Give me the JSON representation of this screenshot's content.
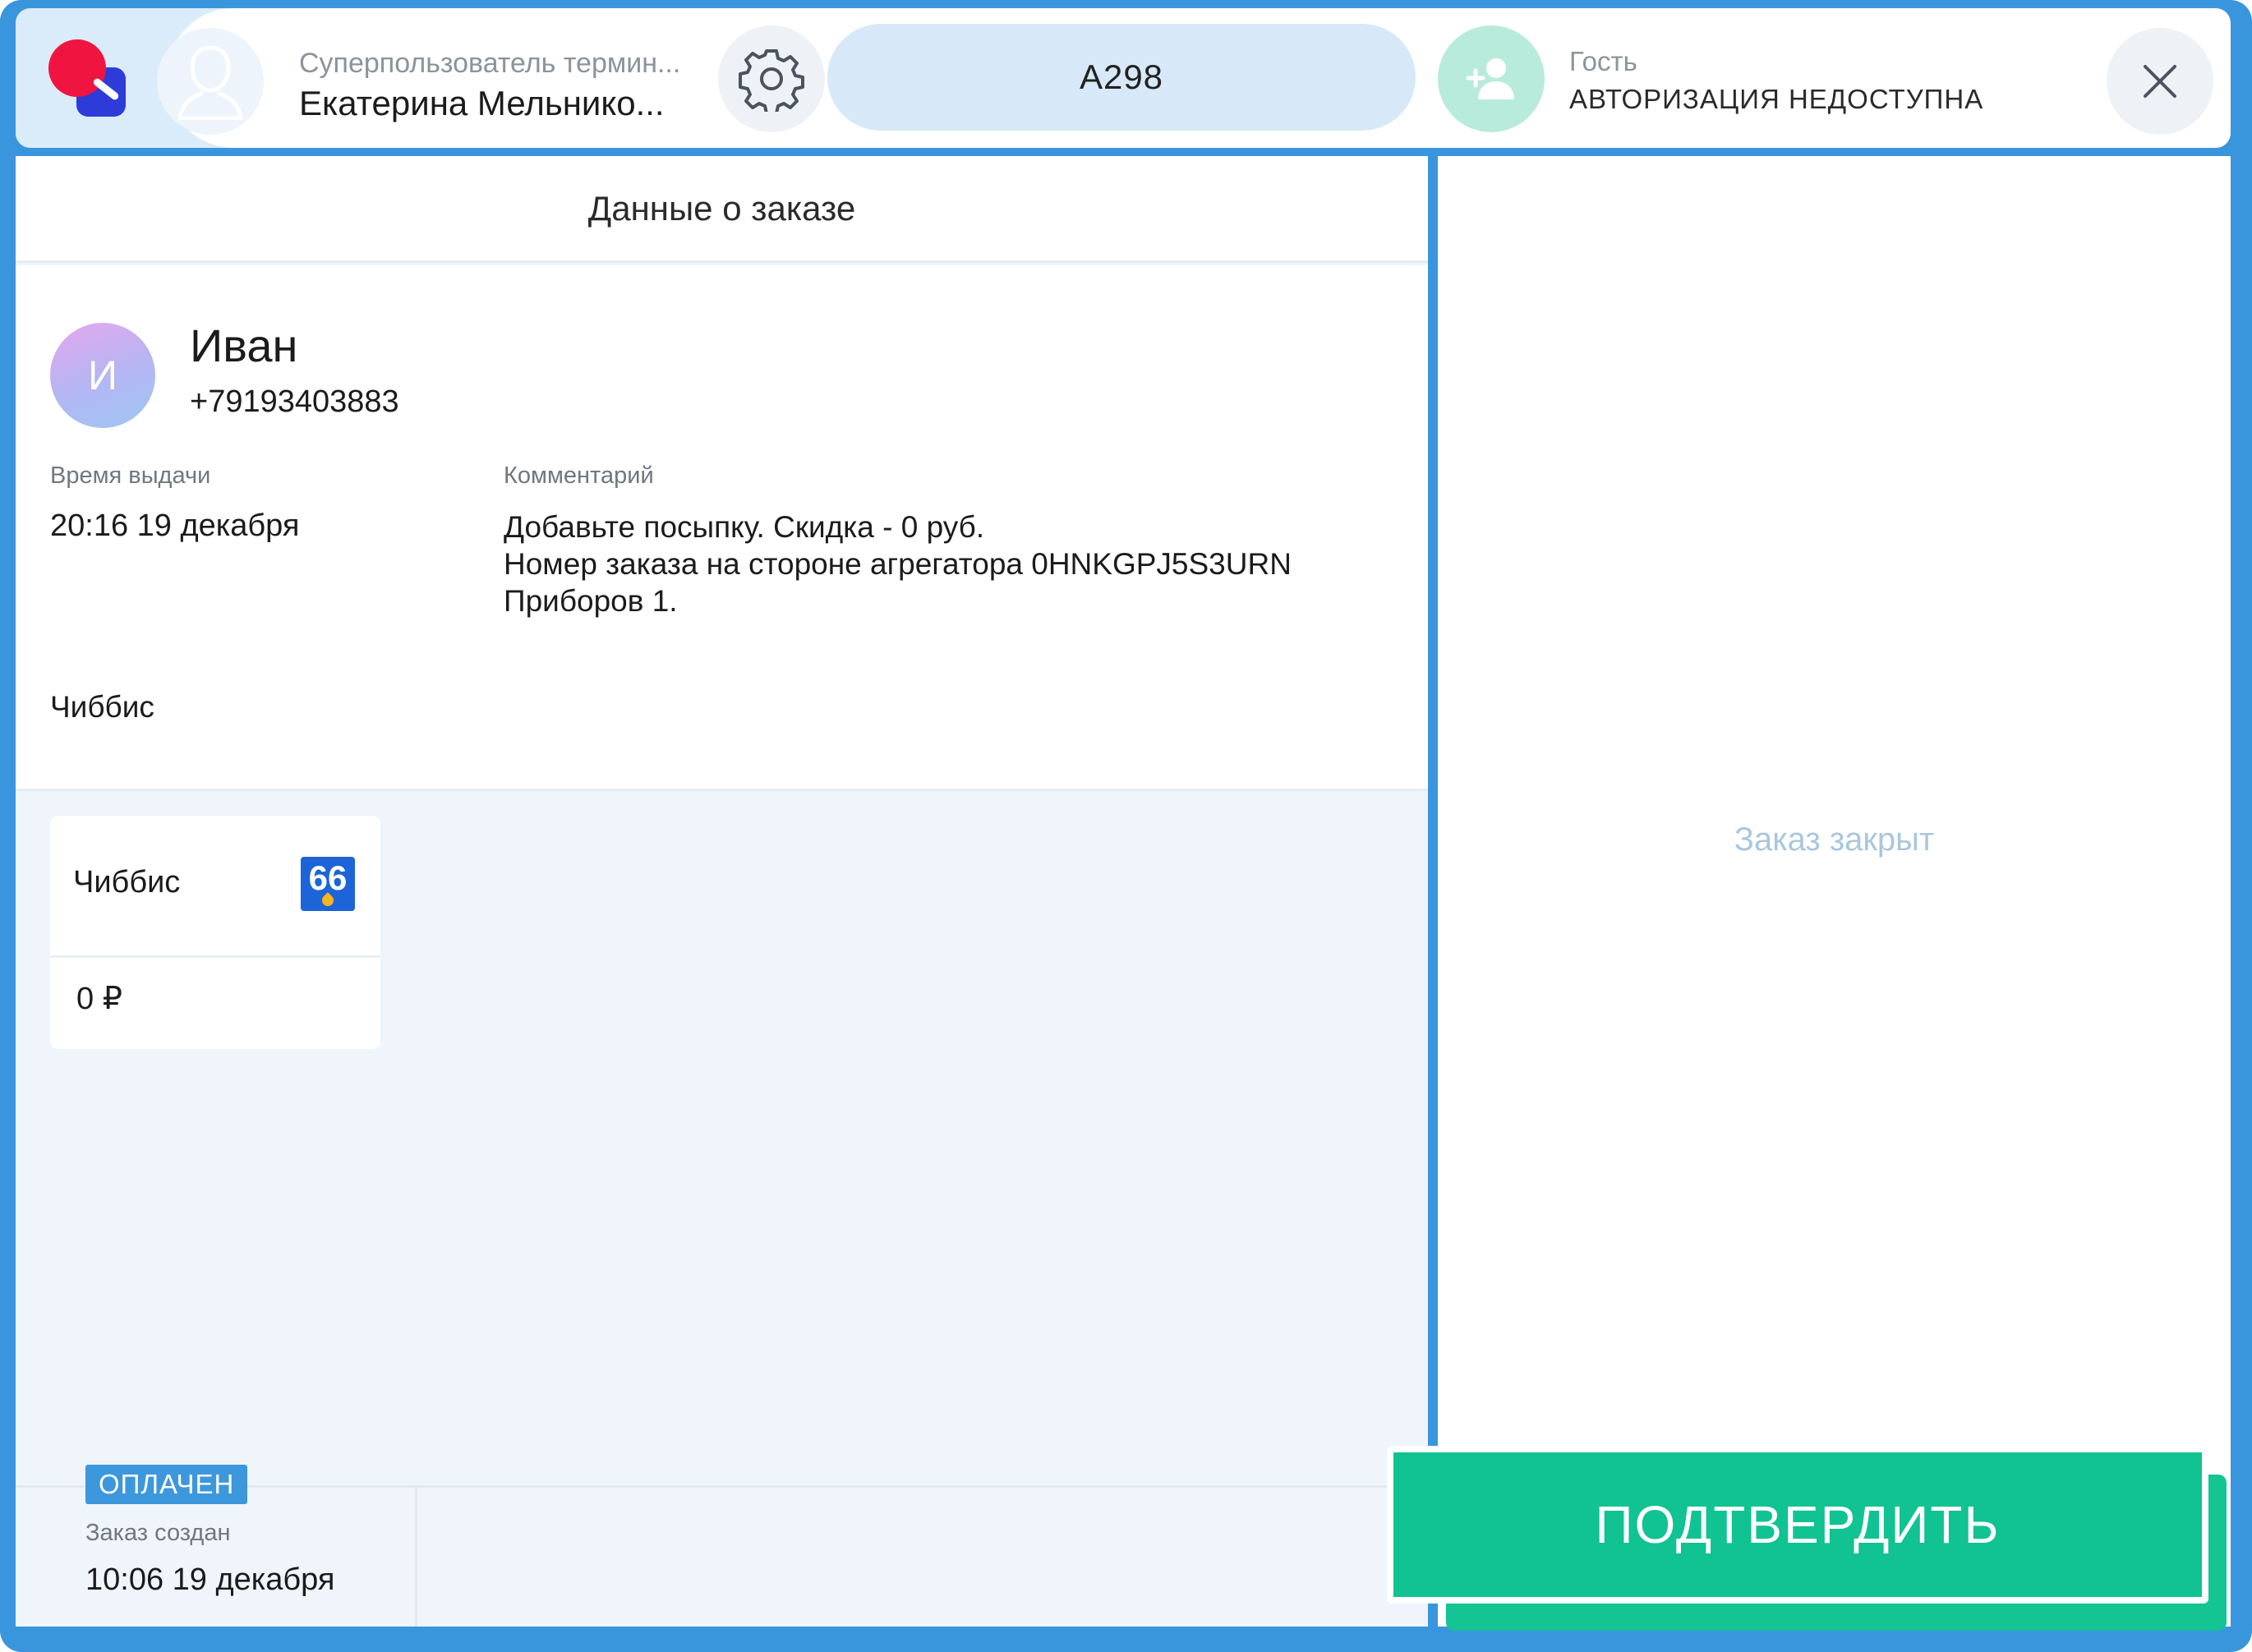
{
  "header": {
    "user_role": "Суперпользователь термин...",
    "user_name": "Екатерина Мельнико...",
    "order_number": "А298",
    "guest_label": "Гость",
    "guest_status": "АВТОРИЗАЦИЯ НЕДОСТУПНА"
  },
  "order_panel": {
    "title": "Данные о заказе",
    "client": {
      "initial": "И",
      "name": "Иван",
      "phone": "+79193403883"
    },
    "pickup_time_label": "Время выдачи",
    "pickup_time": "20:16 19 декабря",
    "comment_label": "Комментарий",
    "comment_lines": [
      "Добавьте посыпку. Скидка - 0  руб.",
      "Номер заказа на стороне агрегатора 0HNKGPJ5S3URN",
      "Приборов 1."
    ],
    "group_title": "Чиббис",
    "item": {
      "name": "Чиббис",
      "badge_text": "66",
      "price": "0 ₽"
    },
    "paid_badge": "ОПЛАЧЕН",
    "created_label": "Заказ создан",
    "created_time": "10:06 19 декабря"
  },
  "right_panel": {
    "status_text": "Заказ закрыт"
  },
  "confirm_button": "ПОДТВЕРДИТЬ",
  "colors": {
    "frame": "#3a96dc",
    "accent_green": "#11c292",
    "pill": "#d7e9f8",
    "paid_badge": "#3d97dc"
  },
  "icons": [
    "app-logo",
    "user-avatar-icon",
    "gear-icon",
    "add-user-icon",
    "close-icon",
    "chibbis-logo-icon"
  ]
}
